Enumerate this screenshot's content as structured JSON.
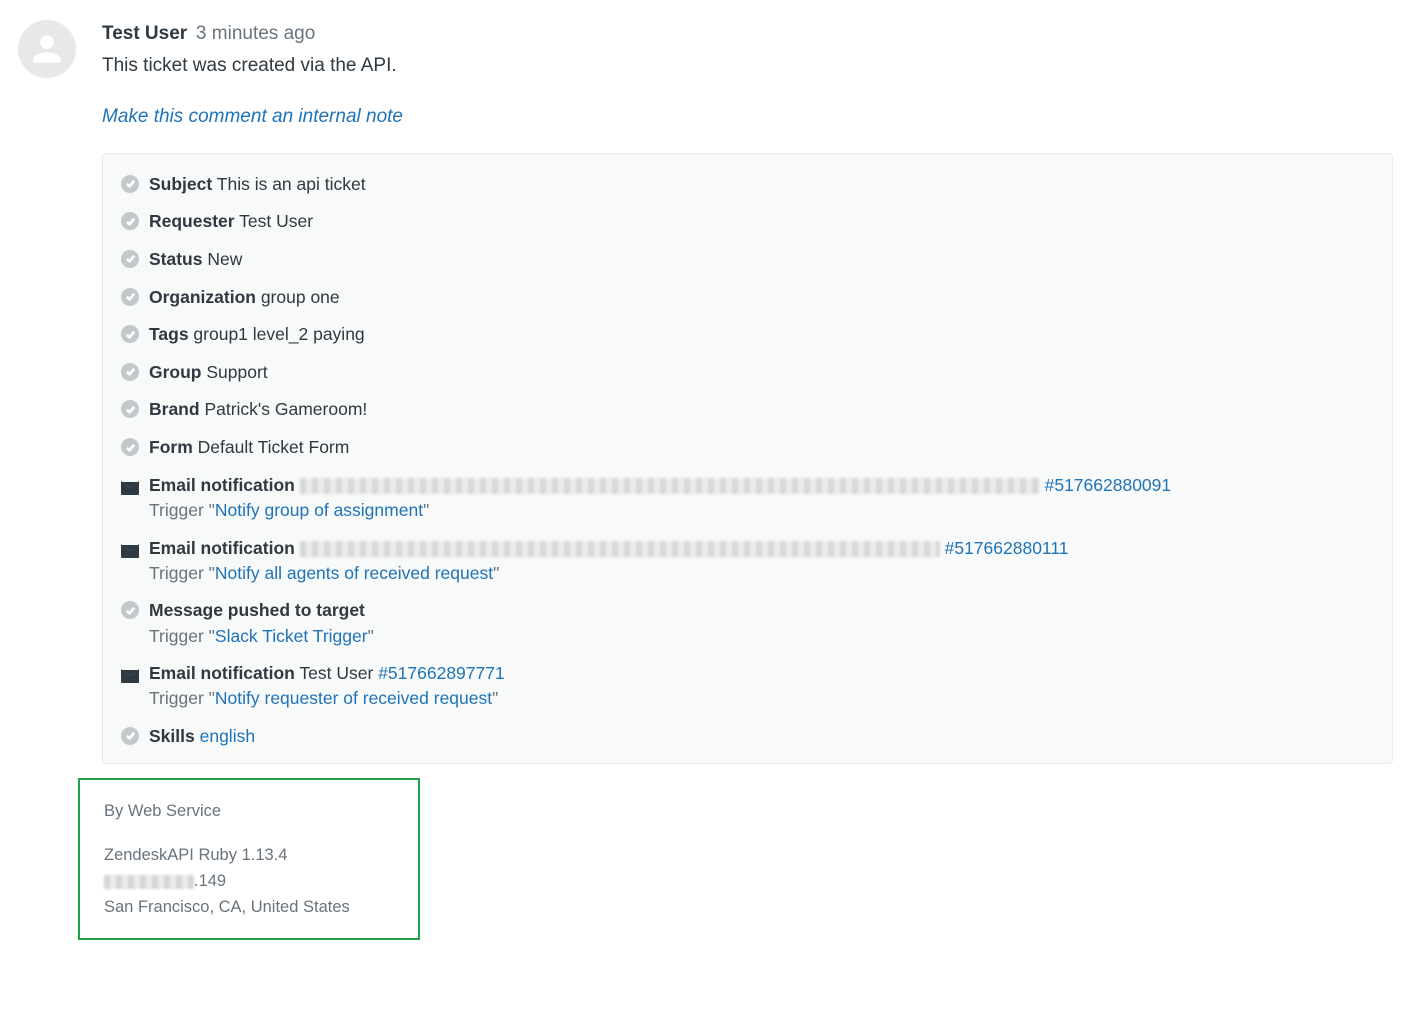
{
  "comment": {
    "author": "Test User",
    "time": "3 minutes ago",
    "body": "This ticket was created via the API.",
    "internal_note_link": "Make this comment an internal note"
  },
  "events": {
    "subject": {
      "label": "Subject",
      "value": "This is an api ticket"
    },
    "requester": {
      "label": "Requester",
      "value": "Test User"
    },
    "status": {
      "label": "Status",
      "value": "New"
    },
    "organization": {
      "label": "Organization",
      "value": "group one"
    },
    "tags": {
      "label": "Tags",
      "value": "group1 level_2 paying"
    },
    "group": {
      "label": "Group",
      "value": "Support"
    },
    "brand": {
      "label": "Brand",
      "value": "Patrick's Gameroom!"
    },
    "form": {
      "label": "Form",
      "value": "Default Ticket Form"
    },
    "email1": {
      "label": "Email notification",
      "ticket": "#517662880091",
      "trigger_label": "Trigger",
      "trigger_name": "Notify group of assignment"
    },
    "email2": {
      "label": "Email notification",
      "ticket": "#517662880111",
      "trigger_label": "Trigger",
      "trigger_name": "Notify all agents of received request"
    },
    "target": {
      "label": "Message pushed to target",
      "trigger_label": "Trigger",
      "trigger_name": "Slack Ticket Trigger"
    },
    "email3": {
      "label": "Email notification",
      "recipient": "Test User",
      "ticket": "#517662897771",
      "trigger_label": "Trigger",
      "trigger_name": "Notify requester of received request"
    },
    "skills": {
      "label": "Skills",
      "value": "english"
    }
  },
  "footer": {
    "by": "By Web Service",
    "client": "ZendeskAPI Ruby 1.13.4",
    "ip_suffix": ".149",
    "location": "San Francisco, CA, United States"
  }
}
